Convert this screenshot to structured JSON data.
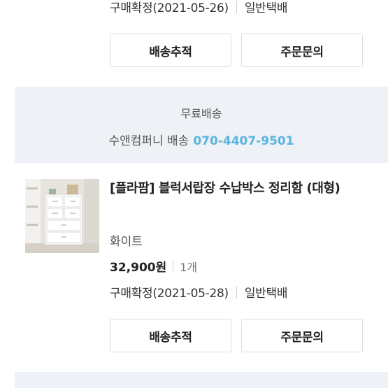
{
  "order1": {
    "status": "구매확정(2021-05-26)",
    "delivery_type": "일반택배",
    "track_button": "배송추적",
    "inquiry_button": "주문문의"
  },
  "shipping": {
    "fee_type": "무료배송",
    "vendor": "수앤컴퍼니 배송",
    "phone": "070-4407-9501"
  },
  "order2": {
    "product_name": "[플라팜] 블럭서랍장 수납박스 정리함 (대형)",
    "option": "화이트",
    "price": "32,900원",
    "quantity": "1개",
    "status": "구매확정(2021-05-28)",
    "delivery_type": "일반택배",
    "track_button": "배송추적",
    "inquiry_button": "주문문의"
  },
  "colors": {
    "phone_accent": "#5ab4e0",
    "panel_bg": "#eef1f5"
  }
}
